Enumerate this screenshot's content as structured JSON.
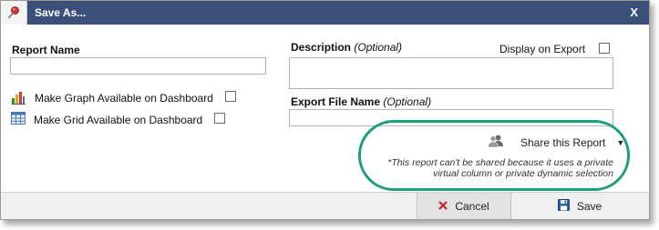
{
  "dialog": {
    "title": "Save As...",
    "close_label": "X"
  },
  "form": {
    "report_name_label": "Report Name",
    "report_name_value": "",
    "graph_label": "Make Graph Available on Dashboard",
    "grid_label": "Make Grid Available on Dashboard",
    "description_label": "Description",
    "optional_label": "(Optional)",
    "display_on_export_label": "Display on Export",
    "export_file_label": "Export File Name",
    "description_value": "",
    "export_file_value": ""
  },
  "share": {
    "label": "Share this Report",
    "note": "*This report can't be shared because it uses a private virtual column or private dynamic selection"
  },
  "footer": {
    "cancel_label": "Cancel",
    "save_label": "Save"
  },
  "colors": {
    "titlebar": "#3a5078",
    "highlight": "#1e9e80",
    "cancel_icon": "#c0262c"
  },
  "icons": {
    "title": "pushpin-icon",
    "graph": "bar-chart-icon",
    "grid": "grid-table-icon",
    "share": "users-icon",
    "cancel": "x-icon",
    "save": "floppy-disk-icon"
  }
}
